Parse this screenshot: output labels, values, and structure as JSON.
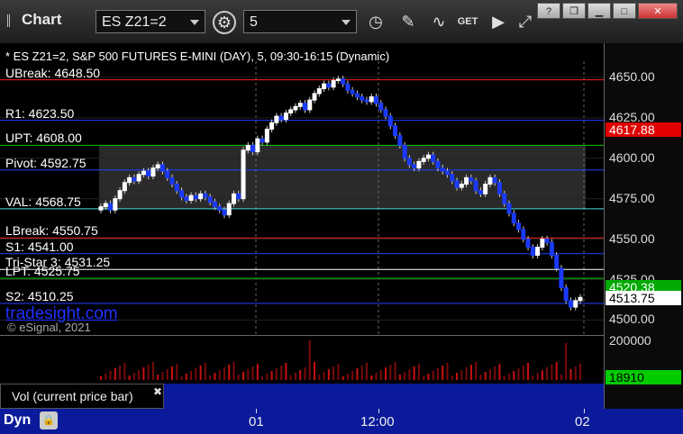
{
  "window": {
    "title": "Chart",
    "symbol": "ES Z21=2",
    "interval": "5"
  },
  "chart": {
    "header": "* ES Z21=2, S&P 500 FUTURES E-MINI (DAY), 5, 09:30-16:15 (Dynamic)",
    "watermark": "tradesight.com",
    "copyright": "© eSignal, 2021",
    "levels": [
      {
        "label": "UBreak: 4648.50",
        "price": 4648.5,
        "color": "#ff2020"
      },
      {
        "label": "R1: 4623.50",
        "price": 4623.5,
        "color": "#2040ff"
      },
      {
        "label": "UPT: 4608.00",
        "price": 4608.0,
        "color": "#00cc00"
      },
      {
        "label": "Pivot: 4592.75",
        "price": 4592.75,
        "color": "#2040ff"
      },
      {
        "label": "VAL: 4568.75",
        "price": 4568.75,
        "color": "#40e0e0"
      },
      {
        "label": "LBreak: 4550.75",
        "price": 4550.75,
        "color": "#ff2020"
      },
      {
        "label": "S1: 4541.00",
        "price": 4541.0,
        "color": "#2040ff"
      },
      {
        "label": "Tri-Star 3: 4531.25",
        "price": 4531.25,
        "color": "#ffffff"
      },
      {
        "label": "LPT: 4525.75",
        "price": 4525.75,
        "color": "#00cc00"
      },
      {
        "label": "S2: 4510.25",
        "price": 4510.25,
        "color": "#2040ff"
      }
    ],
    "y_ticks": [
      "4650.00",
      "4625.00",
      "4600.00",
      "4575.00",
      "4550.00",
      "4525.00",
      "4500.00"
    ],
    "price_tags": [
      {
        "text": "4617.88",
        "bg": "#e00000",
        "fg": "#ffffff",
        "price": 4617.88
      },
      {
        "text": "4520.38",
        "bg": "#00aa00",
        "fg": "#ffffff",
        "price": 4520.38
      },
      {
        "text": "4513.75",
        "bg": "#ffffff",
        "fg": "#000000",
        "price": 4513.75
      }
    ],
    "vol_tick": "200000",
    "vol_tag": "18910",
    "x_labels": [
      "01",
      "12:00",
      "02"
    ],
    "study_label": "Vol (current price bar)",
    "mode": "Dyn"
  },
  "chart_data": {
    "type": "candlestick",
    "ylim": [
      4493,
      4660
    ],
    "closes": [
      4570,
      4572,
      4568,
      4575,
      4580,
      4585,
      4588,
      4586,
      4590,
      4592,
      4589,
      4594,
      4596,
      4592,
      4588,
      4584,
      4580,
      4576,
      4574,
      4577,
      4575,
      4578,
      4576,
      4573,
      4570,
      4568,
      4565,
      4572,
      4578,
      4575,
      4605,
      4608,
      4604,
      4612,
      4610,
      4618,
      4622,
      4626,
      4624,
      4628,
      4630,
      4632,
      4634,
      4630,
      4636,
      4640,
      4643,
      4646,
      4644,
      4648,
      4649,
      4646,
      4642,
      4640,
      4638,
      4636,
      4635,
      4638,
      4634,
      4630,
      4626,
      4620,
      4614,
      4608,
      4600,
      4596,
      4594,
      4598,
      4600,
      4602,
      4598,
      4594,
      4592,
      4590,
      4586,
      4582,
      4584,
      4588,
      4586,
      4580,
      4578,
      4584,
      4588,
      4585,
      4578,
      4572,
      4566,
      4560,
      4556,
      4550,
      4545,
      4540,
      4545,
      4550,
      4548,
      4540,
      4532,
      4520,
      4512,
      4508,
      4512,
      4514
    ]
  }
}
